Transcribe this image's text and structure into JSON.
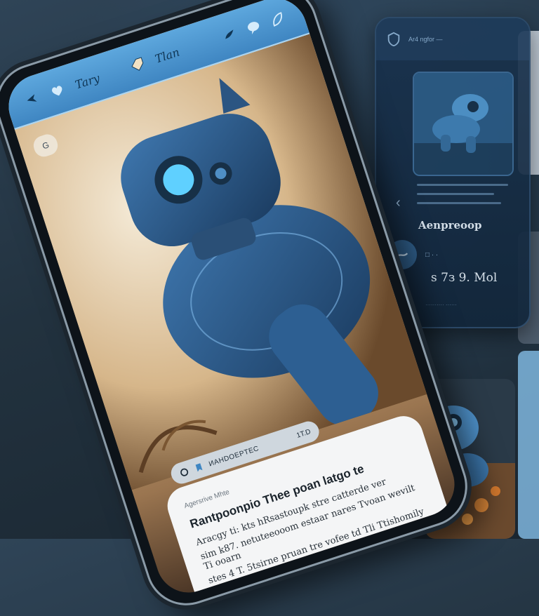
{
  "app_bar": {
    "title": "Tary",
    "label_center": "Tlan",
    "icons": [
      "arrow-icon",
      "heart-icon",
      "tag-icon",
      "bird-icon",
      "chat-icon",
      "leaf-icon"
    ]
  },
  "hero": {
    "badge": "G",
    "subject": "blue robot illustration"
  },
  "bottom_pill": {
    "text": "ИAHDOEPTEC",
    "number": "1T.D"
  },
  "card": {
    "subtitle": "Agersrive Mhte",
    "title": "Rantpoonpio Thee  poan latgo  te",
    "lines": [
      "Aracgy ti: kts  hRsastoupk stre  catterde  ver",
      "sim k87. netuteeooom  estaar  nares  Tvoan  wevilt  Ti  ooarn",
      "stes  4  T. 5tsirne pruan  tre  vofee  td  Tli  Ttishomily"
    ]
  },
  "panel2": {
    "header_text": "Ar4  ngfor  —",
    "title": "Aenpreoop",
    "mini": "□  ·  ·",
    "price": "s  7з  9. Mol",
    "footer": "··········  ······"
  },
  "colors": {
    "accent": "#4f9fdb",
    "background": "#22323f",
    "panel": "#12263b",
    "card": "#f4f5f6"
  }
}
